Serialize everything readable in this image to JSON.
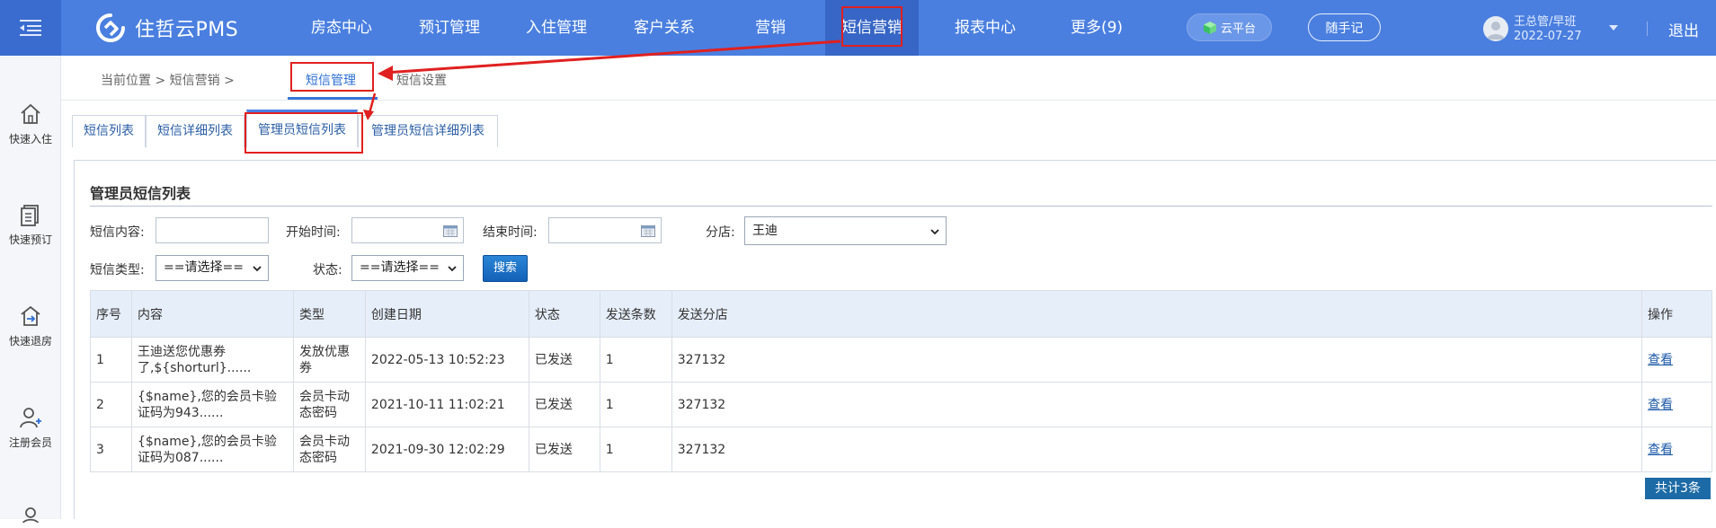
{
  "header": {
    "brand": "住哲云PMS",
    "nav": [
      {
        "label": "房态中心",
        "active": false
      },
      {
        "label": "预订管理",
        "active": false
      },
      {
        "label": "入住管理",
        "active": false
      },
      {
        "label": "客户关系",
        "active": false
      },
      {
        "label": "营销",
        "active": false
      },
      {
        "label": "短信营销",
        "active": true
      },
      {
        "label": "报表中心",
        "active": false
      },
      {
        "label": "更多(9)",
        "active": false
      }
    ],
    "cloud_label": "云平台",
    "memo_label": "随手记",
    "user_name": "王总管/早班",
    "user_date": "2022-07-27",
    "logout": "退出",
    "colors": {
      "primary": "#4a7fe0",
      "active": "#3766c6",
      "highlight": "#e02020"
    }
  },
  "sidebar": {
    "items": [
      {
        "label": "快速入住",
        "icon": "home-icon"
      },
      {
        "label": "快速预订",
        "icon": "document-icon"
      },
      {
        "label": "快速退房",
        "icon": "checkout-icon"
      },
      {
        "label": "注册会员",
        "icon": "add-user-icon"
      }
    ]
  },
  "breadcrumb": {
    "text": "当前位置 > 短信营销 >",
    "tabs": [
      {
        "label": "短信管理",
        "active": true
      },
      {
        "label": "短信设置",
        "active": false
      }
    ]
  },
  "tabs": [
    {
      "label": "短信列表",
      "active": false
    },
    {
      "label": "短信详细列表",
      "active": false
    },
    {
      "label": "管理员短信列表",
      "active": true
    },
    {
      "label": "管理员短信详细列表",
      "active": false
    }
  ],
  "panel": {
    "title": "管理员短信列表",
    "filters": {
      "content_label": "短信内容:",
      "content_value": "",
      "start_label": "开始时间:",
      "start_value": "",
      "end_label": "结束时间:",
      "end_value": "",
      "branch_label": "分店:",
      "branch_value": "王迪",
      "type_label": "短信类型:",
      "type_value": "==请选择==",
      "status_label": "状态:",
      "status_value": "==请选择==",
      "search_label": "搜索"
    },
    "table": {
      "headers": [
        "序号",
        "内容",
        "类型",
        "创建日期",
        "状态",
        "发送条数",
        "发送分店",
        "操作"
      ],
      "rows": [
        {
          "no": "1",
          "content": "王迪送您优惠券了,${shorturl}......",
          "type": "发放优惠券",
          "date": "2022-05-13 10:52:23",
          "status": "已发送",
          "count": "1",
          "branch": "327132",
          "action": "查看"
        },
        {
          "no": "2",
          "content": "{$name},您的会员卡验证码为943......",
          "type": "会员卡动态密码",
          "date": "2021-10-11 11:02:21",
          "status": "已发送",
          "count": "1",
          "branch": "327132",
          "action": "查看"
        },
        {
          "no": "3",
          "content": "{$name},您的会员卡验证码为087......",
          "type": "会员卡动态密码",
          "date": "2021-09-30 12:02:29",
          "status": "已发送",
          "count": "1",
          "branch": "327132",
          "action": "查看"
        }
      ]
    },
    "total": "共计3条"
  }
}
